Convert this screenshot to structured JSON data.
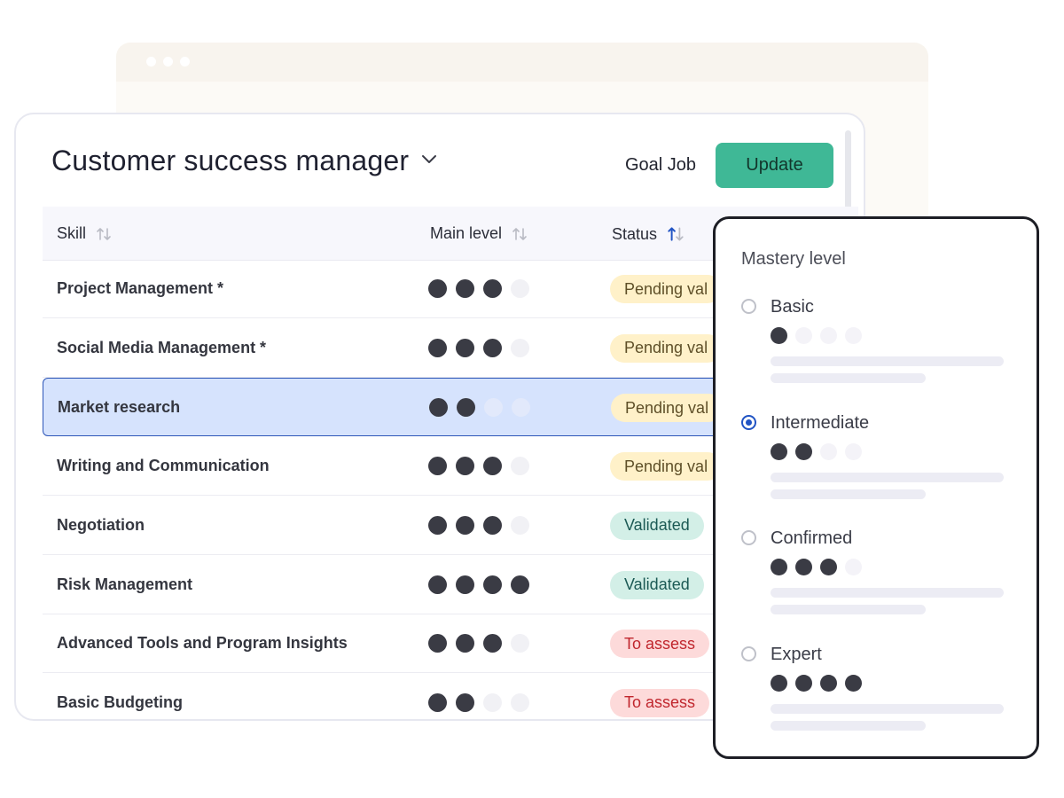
{
  "header": {
    "job_title": "Customer success manager",
    "goal_job_label": "Goal Job",
    "update_label": "Update"
  },
  "table": {
    "columns": [
      "Skill",
      "Main level",
      "Status"
    ],
    "rows": [
      {
        "skill": "Project Management *",
        "level": 3,
        "max": 4,
        "status": "Pending val",
        "status_type": "pending"
      },
      {
        "skill": "Social Media Management *",
        "level": 3,
        "max": 4,
        "status": "Pending val",
        "status_type": "pending"
      },
      {
        "skill": "Market research",
        "level": 2,
        "max": 4,
        "status": "Pending val",
        "status_type": "pending",
        "selected": true
      },
      {
        "skill": "Writing and Communication",
        "level": 3,
        "max": 4,
        "status": "Pending val",
        "status_type": "pending"
      },
      {
        "skill": "Negotiation",
        "level": 3,
        "max": 4,
        "status": "Validated",
        "status_type": "validated"
      },
      {
        "skill": "Risk Management",
        "level": 4,
        "max": 4,
        "status": "Validated",
        "status_type": "validated"
      },
      {
        "skill": "Advanced Tools and Program Insights",
        "level": 3,
        "max": 4,
        "status": "To assess",
        "status_type": "assess"
      },
      {
        "skill": "Basic Budgeting",
        "level": 2,
        "max": 4,
        "status": "To assess",
        "status_type": "assess"
      }
    ]
  },
  "mastery": {
    "title": "Mastery level",
    "options": [
      {
        "label": "Basic",
        "level": 1,
        "checked": false
      },
      {
        "label": "Intermediate",
        "level": 2,
        "checked": true
      },
      {
        "label": "Confirmed",
        "level": 3,
        "checked": false
      },
      {
        "label": "Expert",
        "level": 4,
        "checked": false
      }
    ]
  },
  "colors": {
    "accent_green": "#3fb896",
    "selected_row": "#d6e3fd",
    "radio_selected": "#2154c4"
  },
  "icons": [
    "chevron-down-icon",
    "sort-icon",
    "sort-ascending-icon"
  ]
}
